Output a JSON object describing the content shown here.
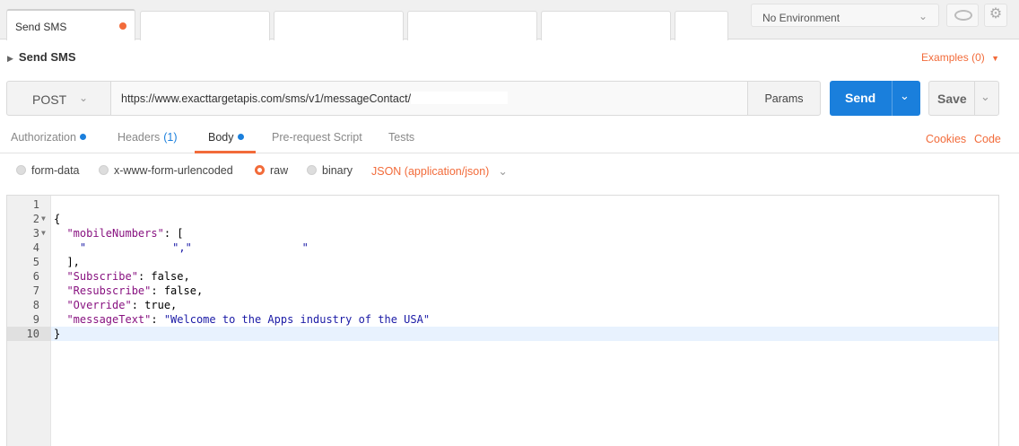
{
  "tabs": {
    "active_label": "Send SMS",
    "environment": "No Environment"
  },
  "request": {
    "name": "Send SMS",
    "examples": "Examples (0)",
    "method": "POST",
    "url": "https://www.exacttargetapis.com/sms/v1/messageContact/",
    "params_label": "Params",
    "send_label": "Send",
    "save_label": "Save"
  },
  "subtabs": {
    "authorization": "Authorization",
    "headers": "Headers",
    "headers_count": "(1)",
    "body": "Body",
    "prerequest": "Pre-request Script",
    "tests": "Tests",
    "cookies": "Cookies",
    "code": "Code"
  },
  "body_types": {
    "form_data": "form-data",
    "urlencoded": "x-www-form-urlencoded",
    "raw": "raw",
    "binary": "binary",
    "selected": "raw",
    "content_type": "JSON (application/json)"
  },
  "editor": {
    "current_line": 10,
    "lines": [
      {
        "n": "1",
        "text": ""
      },
      {
        "n": "2",
        "text": "{"
      },
      {
        "n": "3",
        "key": "\"mobileNumbers\"",
        "rest": ": ["
      },
      {
        "n": "4",
        "text": "    \"",
        "tail": "\",\"                 \""
      },
      {
        "n": "5",
        "text": "  ],"
      },
      {
        "n": "6",
        "key": "\"Subscribe\"",
        "rest": ": false,"
      },
      {
        "n": "7",
        "key": "\"Resubscribe\"",
        "rest": ": false,"
      },
      {
        "n": "8",
        "key": "\"Override\"",
        "rest": ": true,"
      },
      {
        "n": "9",
        "key": "\"messageText\"",
        "rest": ": ",
        "str": "\"Welcome to the Apps industry of the USA\""
      },
      {
        "n": "10",
        "text": "}"
      }
    ]
  },
  "colors": {
    "accent": "#f26b3a",
    "primary": "#1a7fdc",
    "json_key": "#881280",
    "json_string": "#1a1aa6"
  }
}
